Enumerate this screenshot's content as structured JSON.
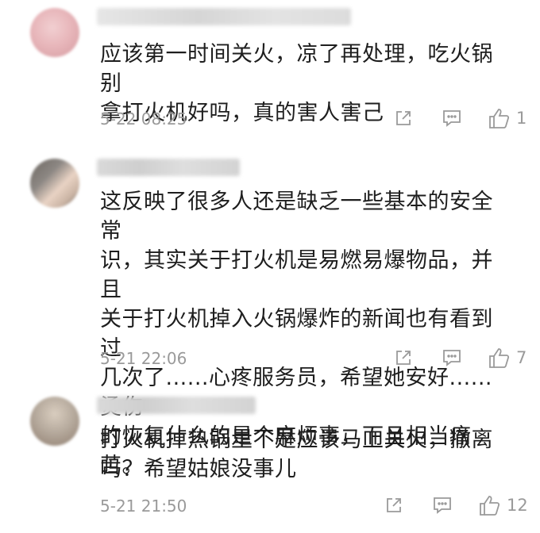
{
  "comments": [
    {
      "text_line1": "应该第一时间关火，凉了再处理，吃火锅别",
      "text_line2": "拿打火机好吗，真的害人害己",
      "time": "5-22 08:25",
      "likes": "1",
      "avatar_colors": [
        "#e8b7bb",
        "#f1cfd1",
        "#d59aa0"
      ]
    },
    {
      "text_line1": "这反映了很多人还是缺乏一些基本的安全常",
      "text_line2": "识，其实关于打火机是易燃易爆物品，并且",
      "text_line3": "关于打火机掉入火锅爆炸的新闻也有看到过",
      "text_line4": "几次了......心疼服务员，希望她安好......烫伤",
      "text_line5": "的恢复什么的是个麻烦事，而且相当痛苦。",
      "time": "5-21 22:06",
      "likes": "7",
      "avatar_colors": [
        "#8c8783",
        "#e9d3c4",
        "#5b5551"
      ]
    },
    {
      "text_line1": "打火机掉热锅里不是应该马上关火，撤离",
      "text_line2": "吗？希望姑娘没事儿",
      "time": "5-21 21:50",
      "likes": "12",
      "avatar_colors": [
        "#b7ab9e",
        "#8f7e70",
        "#d9cdbf"
      ]
    }
  ]
}
